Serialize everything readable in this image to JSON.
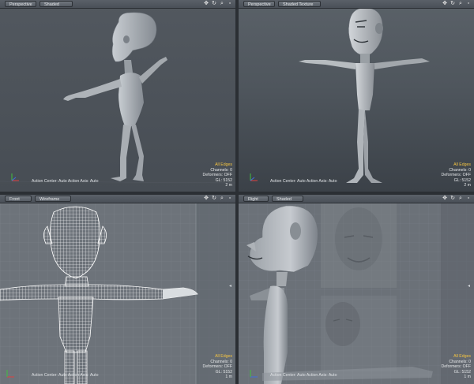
{
  "viewports": [
    {
      "id": "tl",
      "view_label": "Perspective",
      "shading_label": "Shaded",
      "info": {
        "edges": "All Edges",
        "channels": "Channels: 0",
        "deformers": "Deformers: OFF",
        "gl": "GL: 5152",
        "scale": "2 m"
      },
      "footer": "Action Center: Auto     Action Axis: Auto"
    },
    {
      "id": "tr",
      "view_label": "Perspective",
      "shading_label": "Shaded Texture",
      "info": {
        "edges": "All Edges",
        "channels": "Channels: 0",
        "deformers": "Deformers: OFF",
        "gl": "GL: 5152",
        "scale": "2 m"
      },
      "footer": "Action Center: Auto     Action Axis: Auto"
    },
    {
      "id": "bl",
      "view_label": "Front",
      "shading_label": "Wireframe",
      "info": {
        "edges": "All Edges",
        "channels": "Channels: 0",
        "deformers": "Deformers: OFF",
        "gl": "GL: 5152",
        "scale": "1 m"
      },
      "footer": "Action Center: Auto     Action Axis: Auto"
    },
    {
      "id": "br",
      "view_label": "Right",
      "shading_label": "Shaded",
      "info": {
        "edges": "All Edges",
        "channels": "Channels: 0",
        "deformers": "Deformers: OFF",
        "gl": "GL: 5152",
        "scale": "1 m"
      },
      "footer": "Action Center: Auto     Action Axis: Auto"
    }
  ],
  "view_controls": [
    "move-icon",
    "rotate-icon",
    "zoom-icon",
    "maximize-icon"
  ],
  "colors": {
    "highlight": "#f5c542",
    "viewport_bg": "#4b525a",
    "grid_bg": "#8f959b",
    "model": "#9aa0a6"
  }
}
